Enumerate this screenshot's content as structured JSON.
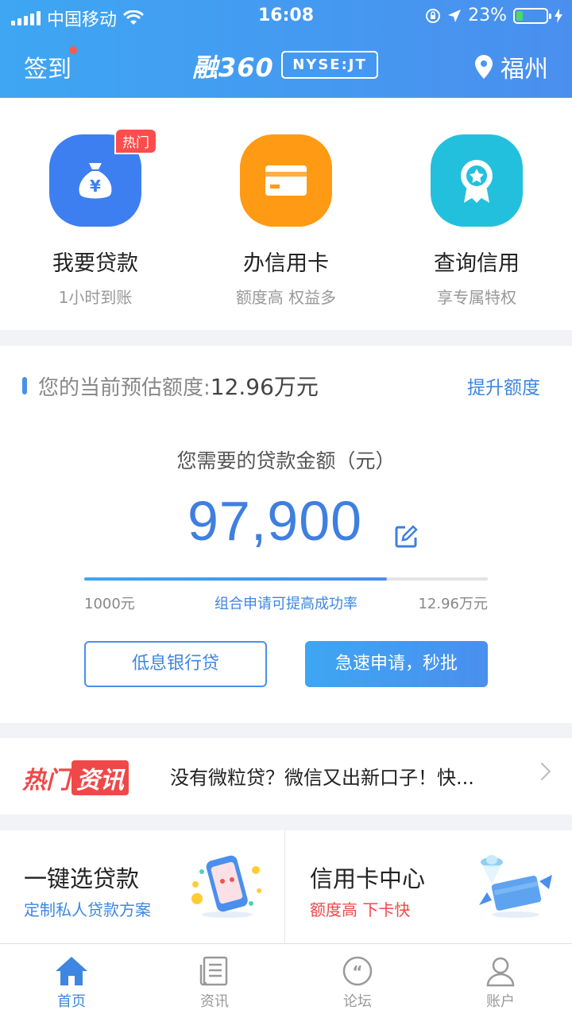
{
  "status_bar": {
    "carrier": "中国移动",
    "time": "16:08",
    "battery_percent": "23%",
    "battery_level": 0.23
  },
  "header": {
    "signin_label": "签到",
    "logo_text": "融360",
    "ticker": "NYSE:JT",
    "location": "福州"
  },
  "quick_actions": [
    {
      "title": "我要贷款",
      "subtitle": "1小时到账",
      "badge": "热门",
      "icon": "money-bag-icon",
      "color": "#3d7ff0"
    },
    {
      "title": "办信用卡",
      "subtitle": "额度高 权益多",
      "icon": "credit-card-icon",
      "color": "#ff9a15"
    },
    {
      "title": "查询信用",
      "subtitle": "享专属特权",
      "icon": "medal-icon",
      "color": "#23c0de"
    }
  ],
  "loan": {
    "limit_label": "您的当前预估额度:",
    "limit_value": "12.96万元",
    "raise_label": "提升额度",
    "need_label": "您需要的贷款金额（元）",
    "amount": "97,900",
    "slider_fraction": 0.75,
    "slider_min": "1000元",
    "slider_hint": "组合申请可提高成功率",
    "slider_max": "12.96万元",
    "btn_secondary": "低息银行贷",
    "btn_primary": "急速申请，秒批"
  },
  "news": {
    "tag_part1": "热门",
    "tag_part2": "资讯",
    "headline": "没有微粒贷？微信又出新口子！快..."
  },
  "cards": [
    {
      "title": "一键选贷款",
      "subtitle": "定制私人贷款方案",
      "subtitle_color": "#3e86e0",
      "icon": "phone-coins-illustration"
    },
    {
      "title": "信用卡中心",
      "subtitle": "额度高 下卡快",
      "subtitle_color": "#f04848",
      "icon": "flying-card-illustration"
    }
  ],
  "tabbar": [
    {
      "label": "首页",
      "icon": "home-icon",
      "active": true
    },
    {
      "label": "资讯",
      "icon": "news-icon",
      "active": false
    },
    {
      "label": "论坛",
      "icon": "forum-icon",
      "active": false
    },
    {
      "label": "账户",
      "icon": "account-icon",
      "active": false
    }
  ],
  "colors": {
    "primary": "#4a8fee",
    "accent_red": "#f04848",
    "tab_active": "#3e86e0",
    "tab_inactive": "#999999"
  }
}
